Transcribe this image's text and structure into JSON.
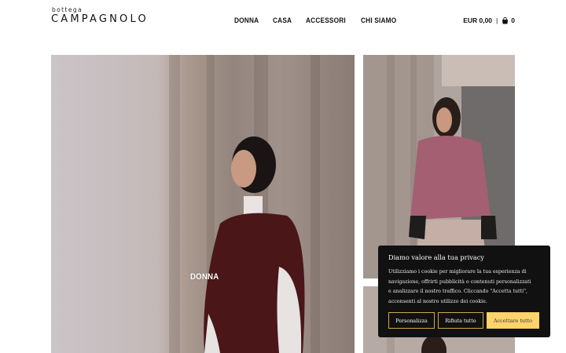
{
  "brand": {
    "small": "bottega",
    "main": "CAMPAGNOLO"
  },
  "nav": {
    "items": [
      "DONNA",
      "CASA",
      "ACCESSORI",
      "CHI SIAMO"
    ]
  },
  "cart": {
    "price": "EUR 0,00",
    "separator": "|",
    "count": "0",
    "icon": "shopping-bag-icon"
  },
  "hero": {
    "label": "DONNA"
  },
  "cookie": {
    "title": "Diamo valore alla tua privacy",
    "text_lines": [
      "Utilizziamo i cookie per migliorare la tua esperienza di",
      "navigazione, offrirti pubblicità o contenuti personalizzati",
      "e analizzare il nostro traffico. Cliccando \"Accetta tutti\",",
      "acconsenti al nostro utilizzo dei cookie."
    ],
    "btn_customize": "Personalizza",
    "btn_reject": "Rifiuta tutto",
    "btn_accept": "Accettare tutto",
    "accent": "#ffd36b",
    "border": "#d2a74a",
    "background": "#111111"
  }
}
